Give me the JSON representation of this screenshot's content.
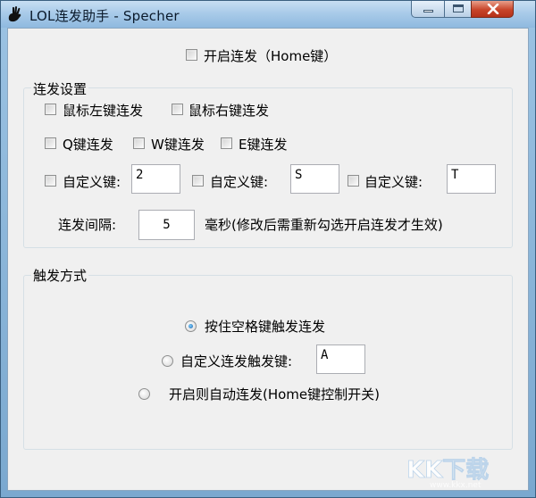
{
  "window": {
    "title": "LOL连发助手 - Specher"
  },
  "top": {
    "enable_label": "开启连发（Home键）"
  },
  "settings": {
    "group_title": "连发设置",
    "left_mouse": "鼠标左键连发",
    "right_mouse": "鼠标右键连发",
    "q_key": "Q键连发",
    "w_key": "W键连发",
    "e_key": "E键连发",
    "custom1_label": "自定义键:",
    "custom1_value": "2",
    "custom2_label": "自定义键:",
    "custom2_value": "S",
    "custom3_label": "自定义键:",
    "custom3_value": "T",
    "interval_label": "连发间隔:",
    "interval_value": "5",
    "interval_note": "毫秒(修改后需重新勾选开启连发才生效)"
  },
  "trigger": {
    "group_title": "触发方式",
    "space_label": "按住空格键触发连发",
    "custom_label": "自定义连发触发键:",
    "custom_value": "A",
    "auto_label": "开启则自动连发(Home键控制开关)",
    "selected": "space"
  },
  "watermark": {
    "text": "KK下载",
    "url": "www.kkx.net"
  }
}
